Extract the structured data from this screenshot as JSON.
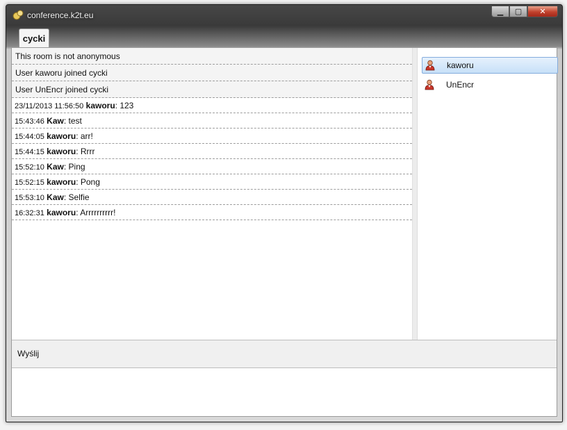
{
  "window": {
    "title": "conference.k2t.eu",
    "controls": {
      "minimize": "▁",
      "maximize": "▢",
      "close": "✕"
    }
  },
  "tabs": [
    {
      "label": "cycki",
      "active": true
    }
  ],
  "status_messages": [
    "This room is not anonymous",
    "User kaworu joined cycki",
    "User UnEncr joined cycki"
  ],
  "chat_messages": [
    {
      "time": "23/11/2013 11:56:50",
      "nick": "kaworu",
      "text": " 123"
    },
    {
      "time": "15:43:46",
      "nick": "Kaw",
      "text": " test"
    },
    {
      "time": "15:44:05",
      "nick": "kaworu",
      "text": " arr!"
    },
    {
      "time": "15:44:15",
      "nick": "kaworu",
      "text": " Rrrr"
    },
    {
      "time": "15:52:10",
      "nick": "Kaw",
      "text": " Ping"
    },
    {
      "time": "15:52:15",
      "nick": "kaworu",
      "text": " Pong"
    },
    {
      "time": "15:53:10",
      "nick": "Kaw",
      "text": " Selfie"
    },
    {
      "time": "16:32:31",
      "nick": "kaworu",
      "text": " Arrrrrrrrrr!"
    }
  ],
  "users": [
    {
      "name": "kaworu",
      "selected": true,
      "icon": "user-icon"
    },
    {
      "name": "UnEncr",
      "selected": false,
      "icon": "user-icon"
    }
  ],
  "send_label": "Wyślij",
  "input": {
    "value": ""
  },
  "colors": {
    "selection": "#c7e0f8",
    "close_button": "#c1412c"
  }
}
